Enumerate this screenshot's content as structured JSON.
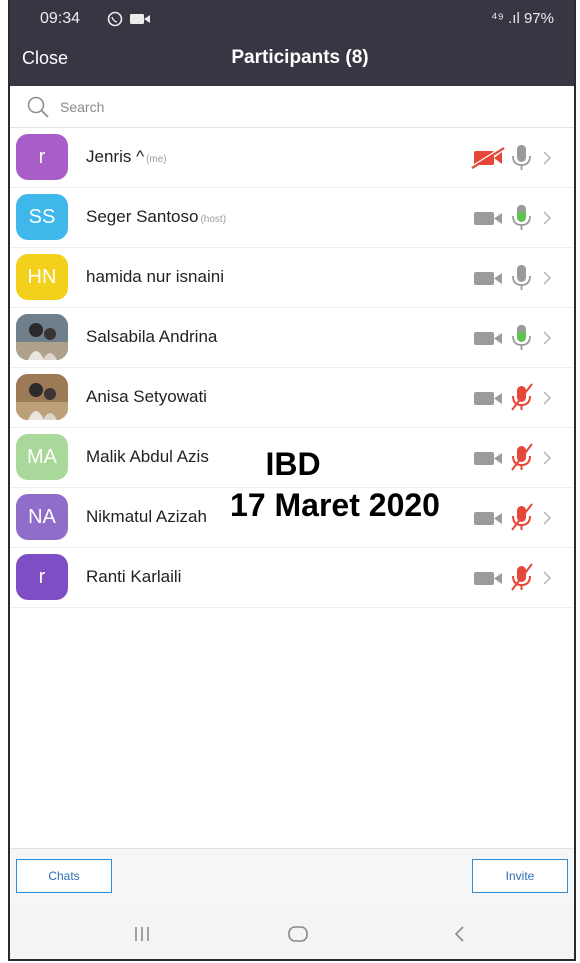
{
  "status_bar": {
    "time": "09:34",
    "signal_battery": "⁴⁹ .ıl 97%"
  },
  "header": {
    "close_label": "Close",
    "title": "Participants (8)"
  },
  "search": {
    "placeholder": "Search",
    "value": ""
  },
  "participants": [
    {
      "initials": "r",
      "name": "Jenris ^",
      "tag": "(me)",
      "avatar_color": "#a95dc9",
      "avatar_type": "initials",
      "video_on": false,
      "video_style": "red-off",
      "mic": "gray"
    },
    {
      "initials": "SS",
      "name": "Seger Santoso",
      "tag": "(host)",
      "avatar_color": "#3fb7ea",
      "avatar_type": "initials",
      "video_on": false,
      "video_style": "gray",
      "mic": "green"
    },
    {
      "initials": "HN",
      "name": "hamida nur isnaini",
      "tag": "",
      "avatar_color": "#f3d01c",
      "avatar_type": "initials",
      "video_on": false,
      "video_style": "gray",
      "mic": "gray"
    },
    {
      "initials": "",
      "name": "Salsabila Andrina",
      "tag": "",
      "avatar_color": "#6f7f8c",
      "avatar_type": "photo",
      "video_on": false,
      "video_style": "gray",
      "mic": "green"
    },
    {
      "initials": "",
      "name": "Anisa Setyowati",
      "tag": "",
      "avatar_color": "#9c7a55",
      "avatar_type": "photo",
      "video_on": false,
      "video_style": "gray",
      "mic": "red-muted"
    },
    {
      "initials": "MA",
      "name": "Malik Abdul Azis",
      "tag": "",
      "avatar_color": "#a9d99a",
      "avatar_type": "initials",
      "video_on": false,
      "video_style": "gray",
      "mic": "red-muted"
    },
    {
      "initials": "NA",
      "name": "Nikmatul Azizah",
      "tag": "",
      "avatar_color": "#8f6ec9",
      "avatar_type": "initials",
      "video_on": false,
      "video_style": "gray",
      "mic": "red-muted"
    },
    {
      "initials": "r",
      "name": "Ranti Karlaili",
      "tag": "",
      "avatar_color": "#7e4fc4",
      "avatar_type": "initials",
      "video_on": false,
      "video_style": "gray",
      "mic": "red-muted"
    }
  ],
  "overlay": {
    "line1": "IBD",
    "line2": "17 Maret 2020"
  },
  "bottom": {
    "chats_label": "Chats",
    "invite_label": "Invite"
  },
  "colors": {
    "header_bg": "#373743",
    "mic_green": "#5cc44c",
    "mic_red": "#e5483b",
    "icon_gray": "#9b9b9b",
    "button_border": "#2e8ed9"
  },
  "android_nav": {
    "icons": [
      "recent-apps-icon",
      "home-icon",
      "back-icon"
    ]
  }
}
